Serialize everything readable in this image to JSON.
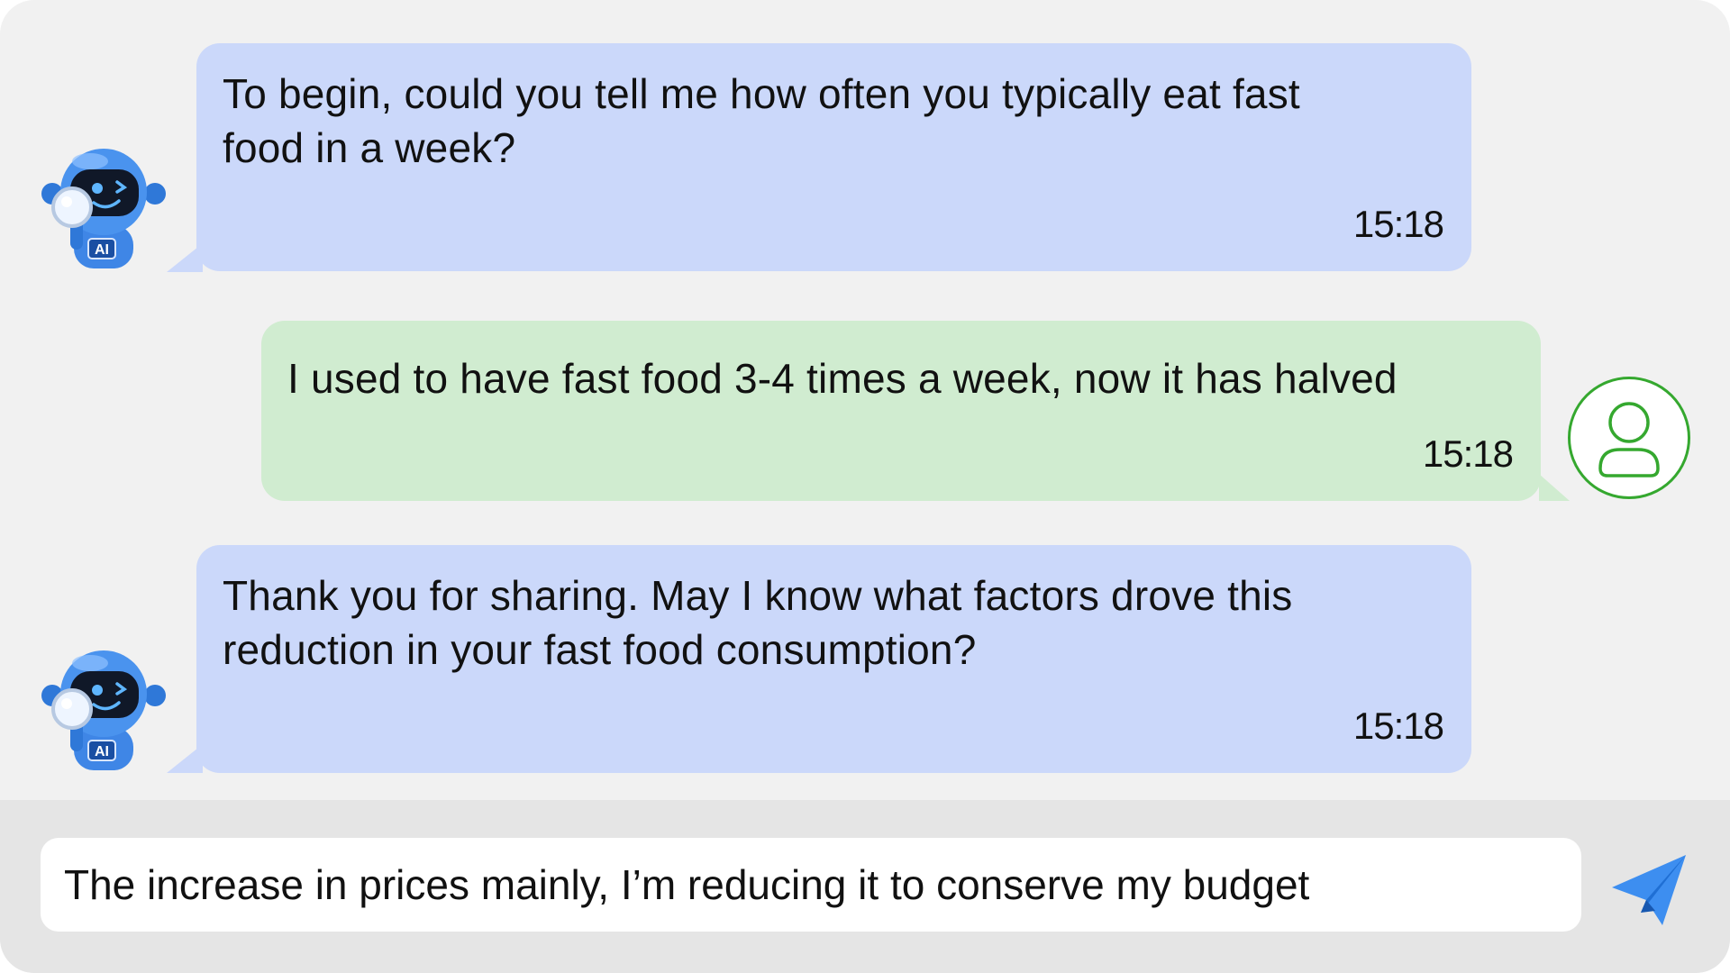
{
  "conversation": {
    "messages": [
      {
        "sender": "bot",
        "text_line1": "To begin, could you tell me how often you typically eat fast",
        "text_line2": "food in a week?",
        "time": "15:18"
      },
      {
        "sender": "user",
        "text_line1": "I used to have fast food 3-4 times a week, now it has halved",
        "time": "15:18"
      },
      {
        "sender": "bot",
        "text_line1": "Thank you for sharing. May I know what factors drove this",
        "text_line2": "reduction in your fast food consumption?",
        "time": "15:18"
      }
    ]
  },
  "bot_avatar": {
    "icon": "robot-mascot-icon",
    "badge_text": "AI"
  },
  "user_avatar": {
    "icon": "user-icon"
  },
  "composer": {
    "input_value": "The increase in prices mainly, I’m reducing it to conserve my budget",
    "send_icon": "paper-plane-send-icon"
  },
  "colors": {
    "background": "#f1f1f1",
    "bot_bubble": "#cbd8fa",
    "user_bubble": "#d0ecd0",
    "user_avatar_stroke": "#35a82f",
    "composer_bar": "#e5e5e5",
    "send_icon": "#3d8ef0"
  }
}
